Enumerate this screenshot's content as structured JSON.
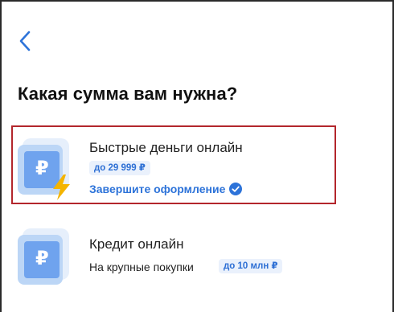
{
  "header": {
    "back_icon": "chevron-left-icon",
    "title": "Какая сумма вам нужна?"
  },
  "offers": [
    {
      "title": "Быстрые деньги онлайн",
      "limit_badge": "до 29 999 ₽",
      "status": "Завершите оформление",
      "icon": "ruble-document-lightning-icon",
      "highlighted": true
    },
    {
      "title": "Кредит онлайн",
      "subtitle": "На крупные покупки",
      "limit_badge": "до 10 млн ₽",
      "icon": "ruble-document-icon",
      "highlighted": false
    }
  ],
  "icon_glyph": "₽",
  "colors": {
    "accent": "#2d73d9",
    "highlight_border": "#b3262c",
    "badge_bg": "#eaf1fc",
    "icon_blue": "#6fa3ee",
    "bolt": "#f4b400"
  }
}
